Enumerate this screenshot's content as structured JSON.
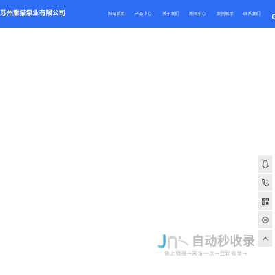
{
  "header": {
    "brand": "苏州熊猫泵业有限公司",
    "background": "#2d6cf5",
    "nav": [
      {
        "label": "网站首页"
      },
      {
        "label": "产品中心"
      },
      {
        "label": "关于我们"
      },
      {
        "label": "新闻中心"
      },
      {
        "label": "案例展示"
      },
      {
        "label": "联系我们"
      }
    ],
    "search_icon": "search-icon"
  },
  "sidebar": {
    "items": [
      {
        "icon": "qq-icon"
      },
      {
        "icon": "phone-icon"
      },
      {
        "icon": "qrcode-icon"
      },
      {
        "icon": "message-icon"
      },
      {
        "icon": "back-to-top-icon"
      }
    ],
    "background": "#ebebeb"
  },
  "watermark": {
    "title": "自动秒收录",
    "subtitle": "做上链接→来访一次→自动收录→"
  }
}
